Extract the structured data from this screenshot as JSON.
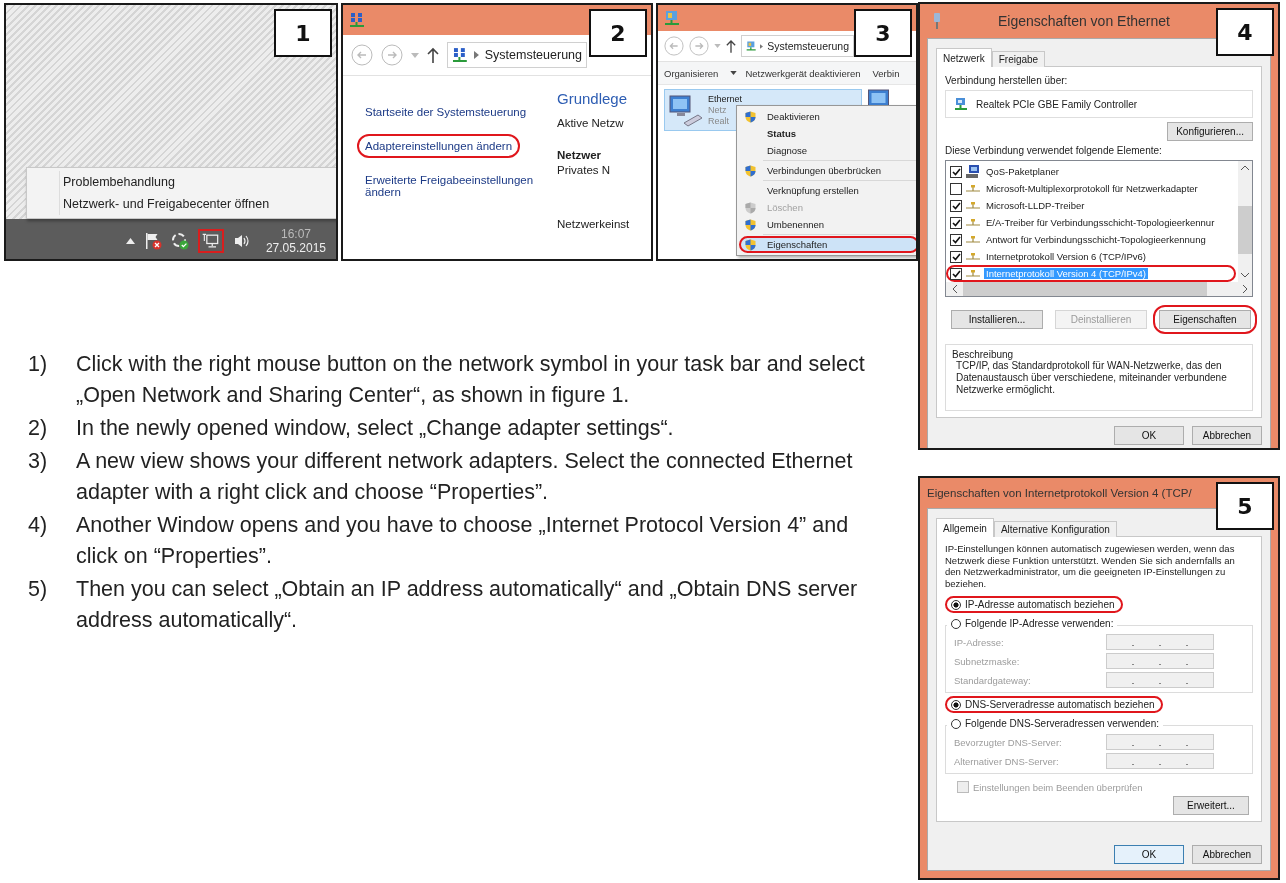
{
  "taskbar_figure": {
    "badge": "1",
    "menu_items": [
      "Problembehandlung",
      "Netzwerk- und Freigabecenter öffnen"
    ],
    "clock_time": "16:07",
    "clock_date": "27.05.2015"
  },
  "control_panel_figure": {
    "badge": "2",
    "breadcrumb": "Systemsteuerung",
    "links": [
      {
        "label": "Startseite der Systemsteuerung",
        "circled": false
      },
      {
        "label": "Adaptereinstellungen ändern",
        "circled": true
      },
      {
        "label": "Erweiterte Freigabeeinstellungen ändern",
        "circled": false
      }
    ],
    "heading": "Grundlege",
    "active_networks_label": "Aktive Netzw",
    "network_name": "Netzwer",
    "network_type": "Privates N",
    "settings_label": "Netzwerkeinst"
  },
  "adapters_figure": {
    "badge": "3",
    "breadcrumb": "Systemsteuerung",
    "toolbar": [
      "Organisieren",
      "Netzwerkgerät deaktivieren",
      "Verbin"
    ],
    "adapter": {
      "name": "Ethernet",
      "status": "Netz",
      "device": "Realt"
    },
    "context_menu": [
      {
        "label": "Deaktivieren",
        "kind": "shield",
        "bold": false,
        "disabled": false,
        "selected": false,
        "circled": false,
        "separator_before": false
      },
      {
        "label": "Status",
        "kind": "plain",
        "bold": true,
        "disabled": false,
        "selected": false,
        "circled": false,
        "separator_before": false
      },
      {
        "label": "Diagnose",
        "kind": "plain",
        "bold": false,
        "disabled": false,
        "selected": false,
        "circled": false,
        "separator_before": false
      },
      {
        "label": "Verbindungen überbrücken",
        "kind": "shield",
        "bold": false,
        "disabled": false,
        "selected": false,
        "circled": false,
        "separator_before": true
      },
      {
        "label": "Verknüpfung erstellen",
        "kind": "plain",
        "bold": false,
        "disabled": false,
        "selected": false,
        "circled": false,
        "separator_before": true
      },
      {
        "label": "Löschen",
        "kind": "shield",
        "bold": false,
        "disabled": true,
        "selected": false,
        "circled": false,
        "separator_before": false
      },
      {
        "label": "Umbenennen",
        "kind": "shield",
        "bold": false,
        "disabled": false,
        "selected": false,
        "circled": false,
        "separator_before": false
      },
      {
        "label": "Eigenschaften",
        "kind": "shield",
        "bold": false,
        "disabled": false,
        "selected": true,
        "circled": true,
        "separator_before": true
      }
    ]
  },
  "ethernet_dialog": {
    "badge": "4",
    "title": "Eigenschaften von Ethernet",
    "tabs": [
      {
        "label": "Netzwerk",
        "selected": true
      },
      {
        "label": "Freigabe",
        "selected": false
      }
    ],
    "connect_label": "Verbindung herstellen über:",
    "device": "Realtek PCIe GBE Family Controller",
    "configure_button": "Konfigurieren...",
    "items_label": "Diese Verbindung verwendet folgende Elemente:",
    "items": [
      {
        "label": "QoS-Paketplaner",
        "kind": "scheduler",
        "checked": true,
        "selected": false,
        "circled": false
      },
      {
        "label": "Microsoft-Multiplexorprotokoll für Netzwerkadapter",
        "kind": "protocol",
        "checked": false,
        "selected": false,
        "circled": false
      },
      {
        "label": "Microsoft-LLDP-Treiber",
        "kind": "protocol",
        "checked": true,
        "selected": false,
        "circled": false
      },
      {
        "label": "E/A-Treiber für Verbindungsschicht-Topologieerkennur",
        "kind": "protocol",
        "checked": true,
        "selected": false,
        "circled": false
      },
      {
        "label": "Antwort für Verbindungsschicht-Topologieerkennung",
        "kind": "protocol",
        "checked": true,
        "selected": false,
        "circled": false
      },
      {
        "label": "Internetprotokoll Version 6 (TCP/IPv6)",
        "kind": "protocol",
        "checked": true,
        "selected": false,
        "circled": false
      },
      {
        "label": "Internetprotokoll Version 4 (TCP/IPv4)",
        "kind": "protocol",
        "checked": true,
        "selected": true,
        "circled": true
      }
    ],
    "buttons": [
      {
        "label": "Installieren...",
        "disabled": false,
        "circled": false
      },
      {
        "label": "Deinstallieren",
        "disabled": true,
        "circled": false
      },
      {
        "label": "Eigenschaften",
        "disabled": false,
        "circled": true
      }
    ],
    "description_title": "Beschreibung",
    "description": "TCP/IP, das Standardprotokoll für WAN-Netzwerke, das den Datenaustausch über verschiedene, miteinander verbundene Netzwerke ermöglicht.",
    "footer_buttons": [
      {
        "label": "OK",
        "default": false
      },
      {
        "label": "Abbrechen",
        "default": false
      }
    ]
  },
  "ipv4_dialog": {
    "badge": "5",
    "title": "Eigenschaften von Internetprotokoll Version 4 (TCP/",
    "tabs": [
      {
        "label": "Allgemein",
        "selected": true
      },
      {
        "label": "Alternative Konfiguration",
        "selected": false
      }
    ],
    "intro": "IP-Einstellungen können automatisch zugewiesen werden, wenn das Netzwerk diese Funktion unterstützt. Wenden Sie sich andernfalls an den Netzwerkadministrator, um die geeigneten IP-Einstellungen zu beziehen.",
    "groups": [
      {
        "auto_option": {
          "label": "IP-Adresse automatisch beziehen",
          "selected": true,
          "circled": true
        },
        "manual_option": {
          "label": "Folgende IP-Adresse verwenden:",
          "selected": false
        },
        "fields": [
          "IP-Adresse:",
          "Subnetzmaske:",
          "Standardgateway:"
        ]
      },
      {
        "auto_option": {
          "label": "DNS-Serveradresse automatisch beziehen",
          "selected": true,
          "circled": true
        },
        "manual_option": {
          "label": "Folgende DNS-Serveradressen verwenden:",
          "selected": false
        },
        "fields": [
          "Bevorzugter DNS-Server:",
          "Alternativer DNS-Server:"
        ]
      }
    ],
    "validate_checkbox": {
      "label": "Einstellungen beim Beenden überprüfen",
      "checked": false,
      "disabled": true
    },
    "advanced_button": "Erweitert...",
    "footer_buttons": [
      {
        "label": "OK",
        "default": true
      },
      {
        "label": "Abbrechen",
        "default": false
      }
    ]
  },
  "instructions": [
    {
      "number": "1)",
      "text": "Click with the right mouse button on the network symbol in your task bar and select „Open Network and Sharing Center“, as shown in figure 1."
    },
    {
      "number": "2)",
      "text": "In the newly opened window, select „Change adapter settings“."
    },
    {
      "number": "3)",
      "text": "A new view shows your different network adapters. Select the connected Ethernet adapter with a right click and choose “Properties”."
    },
    {
      "number": "4)",
      "text": "Another Window opens and you have to choose „Internet Protocol Version 4” and click on “Properties”."
    },
    {
      "number": "5)",
      "text": "Then you can select „Obtain an IP address automatically“ and „Obtain DNS server address automatically“."
    }
  ]
}
